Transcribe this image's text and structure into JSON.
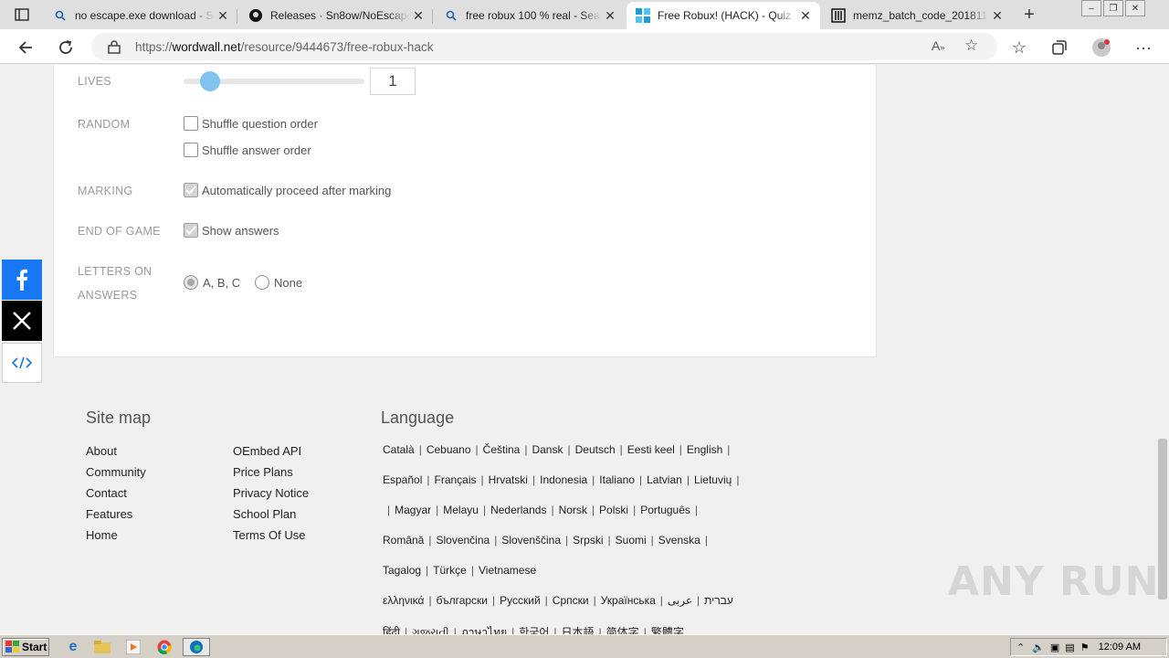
{
  "browser": {
    "tabs": [
      {
        "title": "no escape.exe download - Search",
        "icon": "search-icon",
        "active": false
      },
      {
        "title": "Releases · Sn8ow/NoEscape",
        "icon": "github-icon",
        "active": false
      },
      {
        "title": "free robux 100 % real - Search",
        "icon": "search-icon",
        "active": false
      },
      {
        "title": "Free Robux! (HACK) - Quiz",
        "icon": "wordwall-icon",
        "active": true
      },
      {
        "title": "memz_batch_code_201811",
        "icon": "archive-icon",
        "active": false
      }
    ],
    "url_prefix": "https://",
    "url_host": "wordwall.net",
    "url_path": "/resource/9444673/free-robux-hack"
  },
  "options": {
    "lives_label": "LIVES",
    "lives_value": "1",
    "lives_slider_fraction": 0.1,
    "random_label": "RANDOM",
    "shuffle_questions": "Shuffle question order",
    "shuffle_answers": "Shuffle answer order",
    "marking_label": "MARKING",
    "auto_proceed": "Automatically proceed after marking",
    "end_label": "END OF GAME",
    "show_answers": "Show answers",
    "letters_label_1": "LETTERS ON",
    "letters_label_2": "ANSWERS",
    "letters_abc": "A, B, C",
    "letters_none": "None"
  },
  "footer": {
    "sitemap_title": "Site map",
    "sitemap_col1": [
      "About",
      "Community",
      "Contact",
      "Features",
      "Home"
    ],
    "sitemap_col2": [
      "OEmbed API",
      "Price Plans",
      "Privacy Notice",
      "School Plan",
      "Terms Of Use"
    ],
    "language_title": "Language",
    "language_rows": [
      [
        "Català",
        "Cebuano",
        "Čeština",
        "Dansk",
        "Deutsch",
        "Eesti keel",
        "English"
      ],
      [
        "Español",
        "Français",
        "Hrvatski",
        "Indonesia",
        "Italiano",
        "Latvian",
        "Lietuvių"
      ],
      [
        "",
        "Magyar",
        "Melayu",
        "Nederlands",
        "Norsk",
        "Polski",
        "Português"
      ],
      [
        "Română",
        "Slovenčina",
        "Slovenščina",
        "Srpski",
        "Suomi",
        "Svenska"
      ],
      [
        "Tagalog",
        "Türkçe",
        "Vietnamese"
      ],
      [
        "ελληνικά",
        "български",
        "Русский",
        "Српски",
        "Українська",
        "עברית",
        "عربى"
      ],
      [
        "हिंदी",
        "ગુજરાતી",
        "ภาษาไทย",
        "한국어",
        "日本語",
        "简体字",
        "繁體字"
      ]
    ]
  },
  "watermark": "ANY RUN",
  "taskbar": {
    "start_label": "Start",
    "clock": "12:09 AM"
  }
}
